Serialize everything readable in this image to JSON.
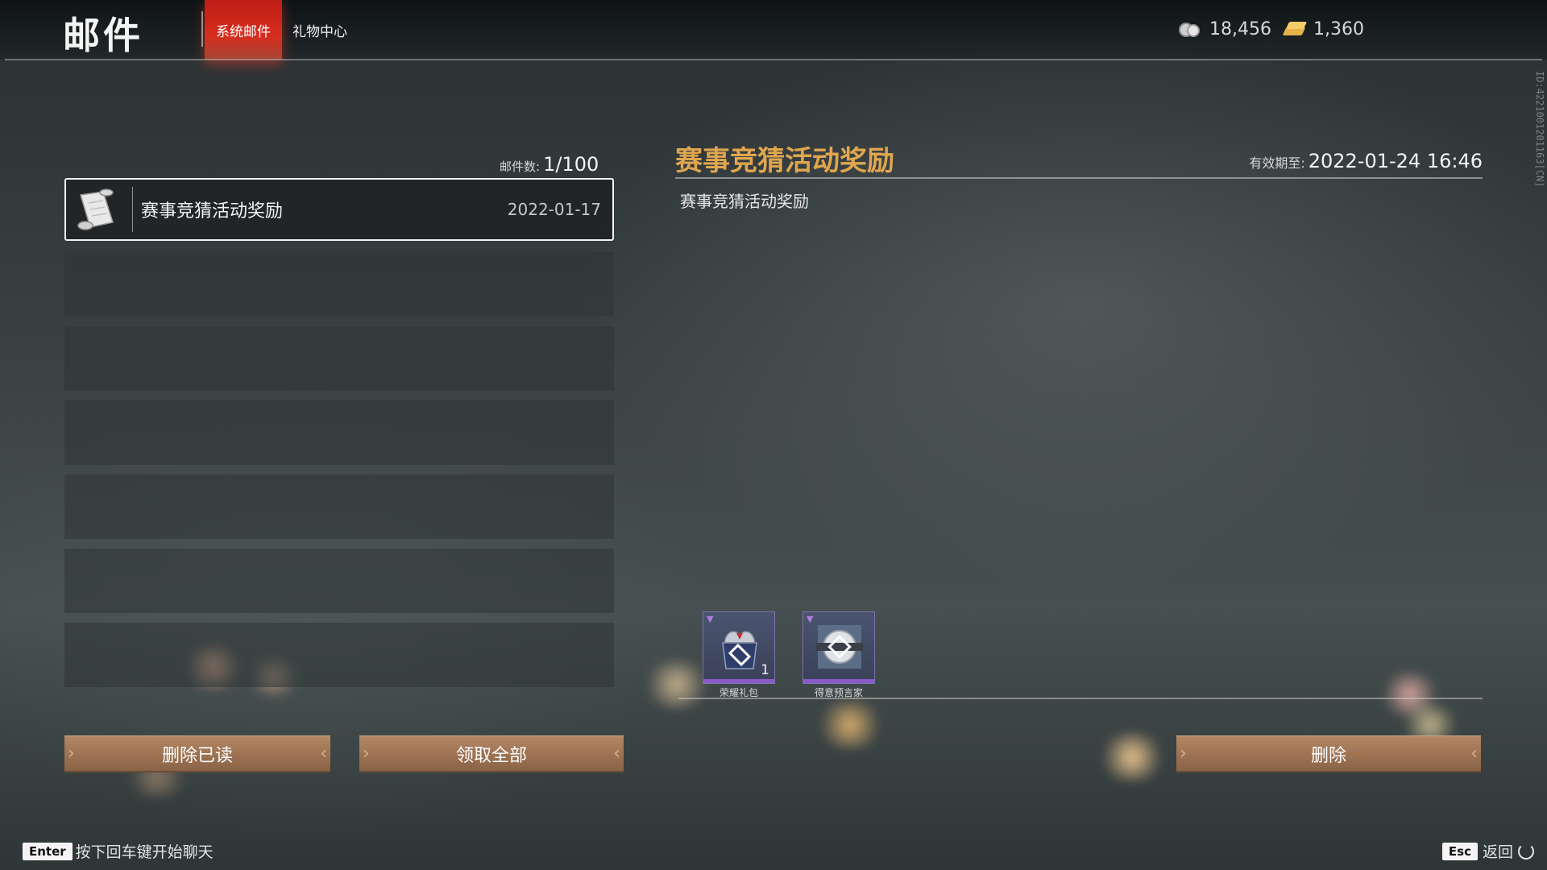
{
  "header": {
    "page_title": "邮件",
    "tabs": [
      {
        "label": "系统邮件",
        "active": true
      },
      {
        "label": "礼物中心",
        "active": false
      }
    ],
    "currencies": [
      {
        "icon": "silver-coin-icon",
        "value": "18,456"
      },
      {
        "icon": "gold-ingot-icon",
        "value": "1,360"
      }
    ]
  },
  "side_id": "ID:4221001201163[CN]",
  "mailbox": {
    "count_label": "邮件数:",
    "count_value": "1/100",
    "items": [
      {
        "title": "赛事竞猜活动奖励",
        "date": "2022-01-17",
        "icon": "scroll-icon",
        "selected": true
      }
    ]
  },
  "detail": {
    "title": "赛事竞猜活动奖励",
    "expiry_label": "有效期至:",
    "expiry_value": "2022-01-24 16:46",
    "body": "赛事竞猜活动奖励",
    "rewards": [
      {
        "name": "荣耀礼包",
        "quantity": "1",
        "icon": "gift-bag-icon"
      },
      {
        "name": "得意预言家",
        "quantity": "",
        "icon": "badge-icon"
      }
    ]
  },
  "buttons": {
    "delete_read": "删除已读",
    "claim_all": "领取全部",
    "delete": "删除"
  },
  "footer": {
    "enter_key": "Enter",
    "enter_hint": "按下回车键开始聊天",
    "esc_key": "Esc",
    "back_label": "返回"
  },
  "colors": {
    "accent_title": "#e0a64f",
    "active_tab": "#e02d1e",
    "button": "#9c7252",
    "reward_rarity": "#8a5ac8"
  }
}
